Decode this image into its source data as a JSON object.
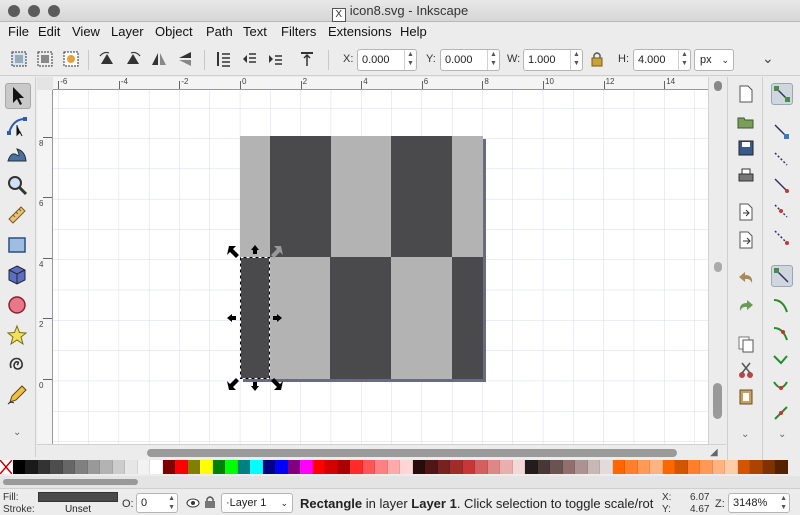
{
  "window": {
    "title": "icon8.svg - Inkscape",
    "app_icon": "x11-icon",
    "app_icon_glyph": "X"
  },
  "menu": [
    "File",
    "Edit",
    "View",
    "Layer",
    "Object",
    "Path",
    "Text",
    "Filters",
    "Extensions",
    "Help"
  ],
  "toolbar": {
    "x_label": "X:",
    "x_value": "0.000",
    "y_label": "Y:",
    "y_value": "0.000",
    "w_label": "W:",
    "w_value": "1.000",
    "h_label": "H:",
    "h_value": "4.000",
    "unit": "px",
    "more": "⌄"
  },
  "rulers": {
    "horizontal": [
      "-8",
      "-6",
      "-4",
      "-2",
      "0",
      "2",
      "4",
      "6",
      "8",
      "10",
      "12",
      "14",
      "16"
    ],
    "vertical": [
      "8",
      "6",
      "4",
      "2",
      "0"
    ]
  },
  "tools": [
    "selector-tool",
    "node-tool",
    "tweak-tool",
    "zoom-tool",
    "measure-tool",
    "rectangle-tool",
    "3d-box-tool",
    "ellipse-tool",
    "star-tool",
    "spiral-tool",
    "pencil-tool"
  ],
  "palette": [
    "#000000",
    "#1a1a1a",
    "#333333",
    "#4d4d4d",
    "#666666",
    "#808080",
    "#999999",
    "#b3b3b3",
    "#cccccc",
    "#e6e6e6",
    "#f2f2f2",
    "#ffffff",
    "#800000",
    "#ff0000",
    "#808000",
    "#ffff00",
    "#008000",
    "#00ff00",
    "#008080",
    "#00ffff",
    "#000080",
    "#0000ff",
    "#800080",
    "#ff00ff",
    "#ff0000",
    "#d40000",
    "#aa0000",
    "#ff2a2a",
    "#ff5555",
    "#ff8080",
    "#ffaaaa",
    "#ffd5d5",
    "#280b0b",
    "#501616",
    "#782121",
    "#a02c2c",
    "#c83737",
    "#d35f5f",
    "#de8787",
    "#e9afaf",
    "#f4d7d7",
    "#241c1c",
    "#483737",
    "#6c5353",
    "#916f6f",
    "#ac9393",
    "#c8b7b7",
    "#e3dbdb",
    "#ff6600",
    "#ff7f2a",
    "#ff9955",
    "#ffb380",
    "#ff6600",
    "#d45500",
    "#ff7f2a",
    "#ff9955",
    "#ffb380",
    "#ffccaa",
    "#d45500",
    "#aa4400",
    "#803300",
    "#552200"
  ],
  "status": {
    "fill_label": "Fill:",
    "fill_color": "#4a4a4a",
    "stroke_label": "Stroke:",
    "stroke_value": "Unset",
    "opacity_label": "O:",
    "opacity_value": "0",
    "layer": "·Layer 1",
    "msg_object": "Rectangle",
    "msg_mid": " in layer ",
    "msg_layer": "Layer 1",
    "msg_tail": ". Click selection to toggle scale/rot",
    "cursor_x_label": "X:",
    "cursor_x": "6.07",
    "cursor_y_label": "Y:",
    "cursor_y": "4.67",
    "zoom_label": "Z:",
    "zoom": "3148%"
  }
}
